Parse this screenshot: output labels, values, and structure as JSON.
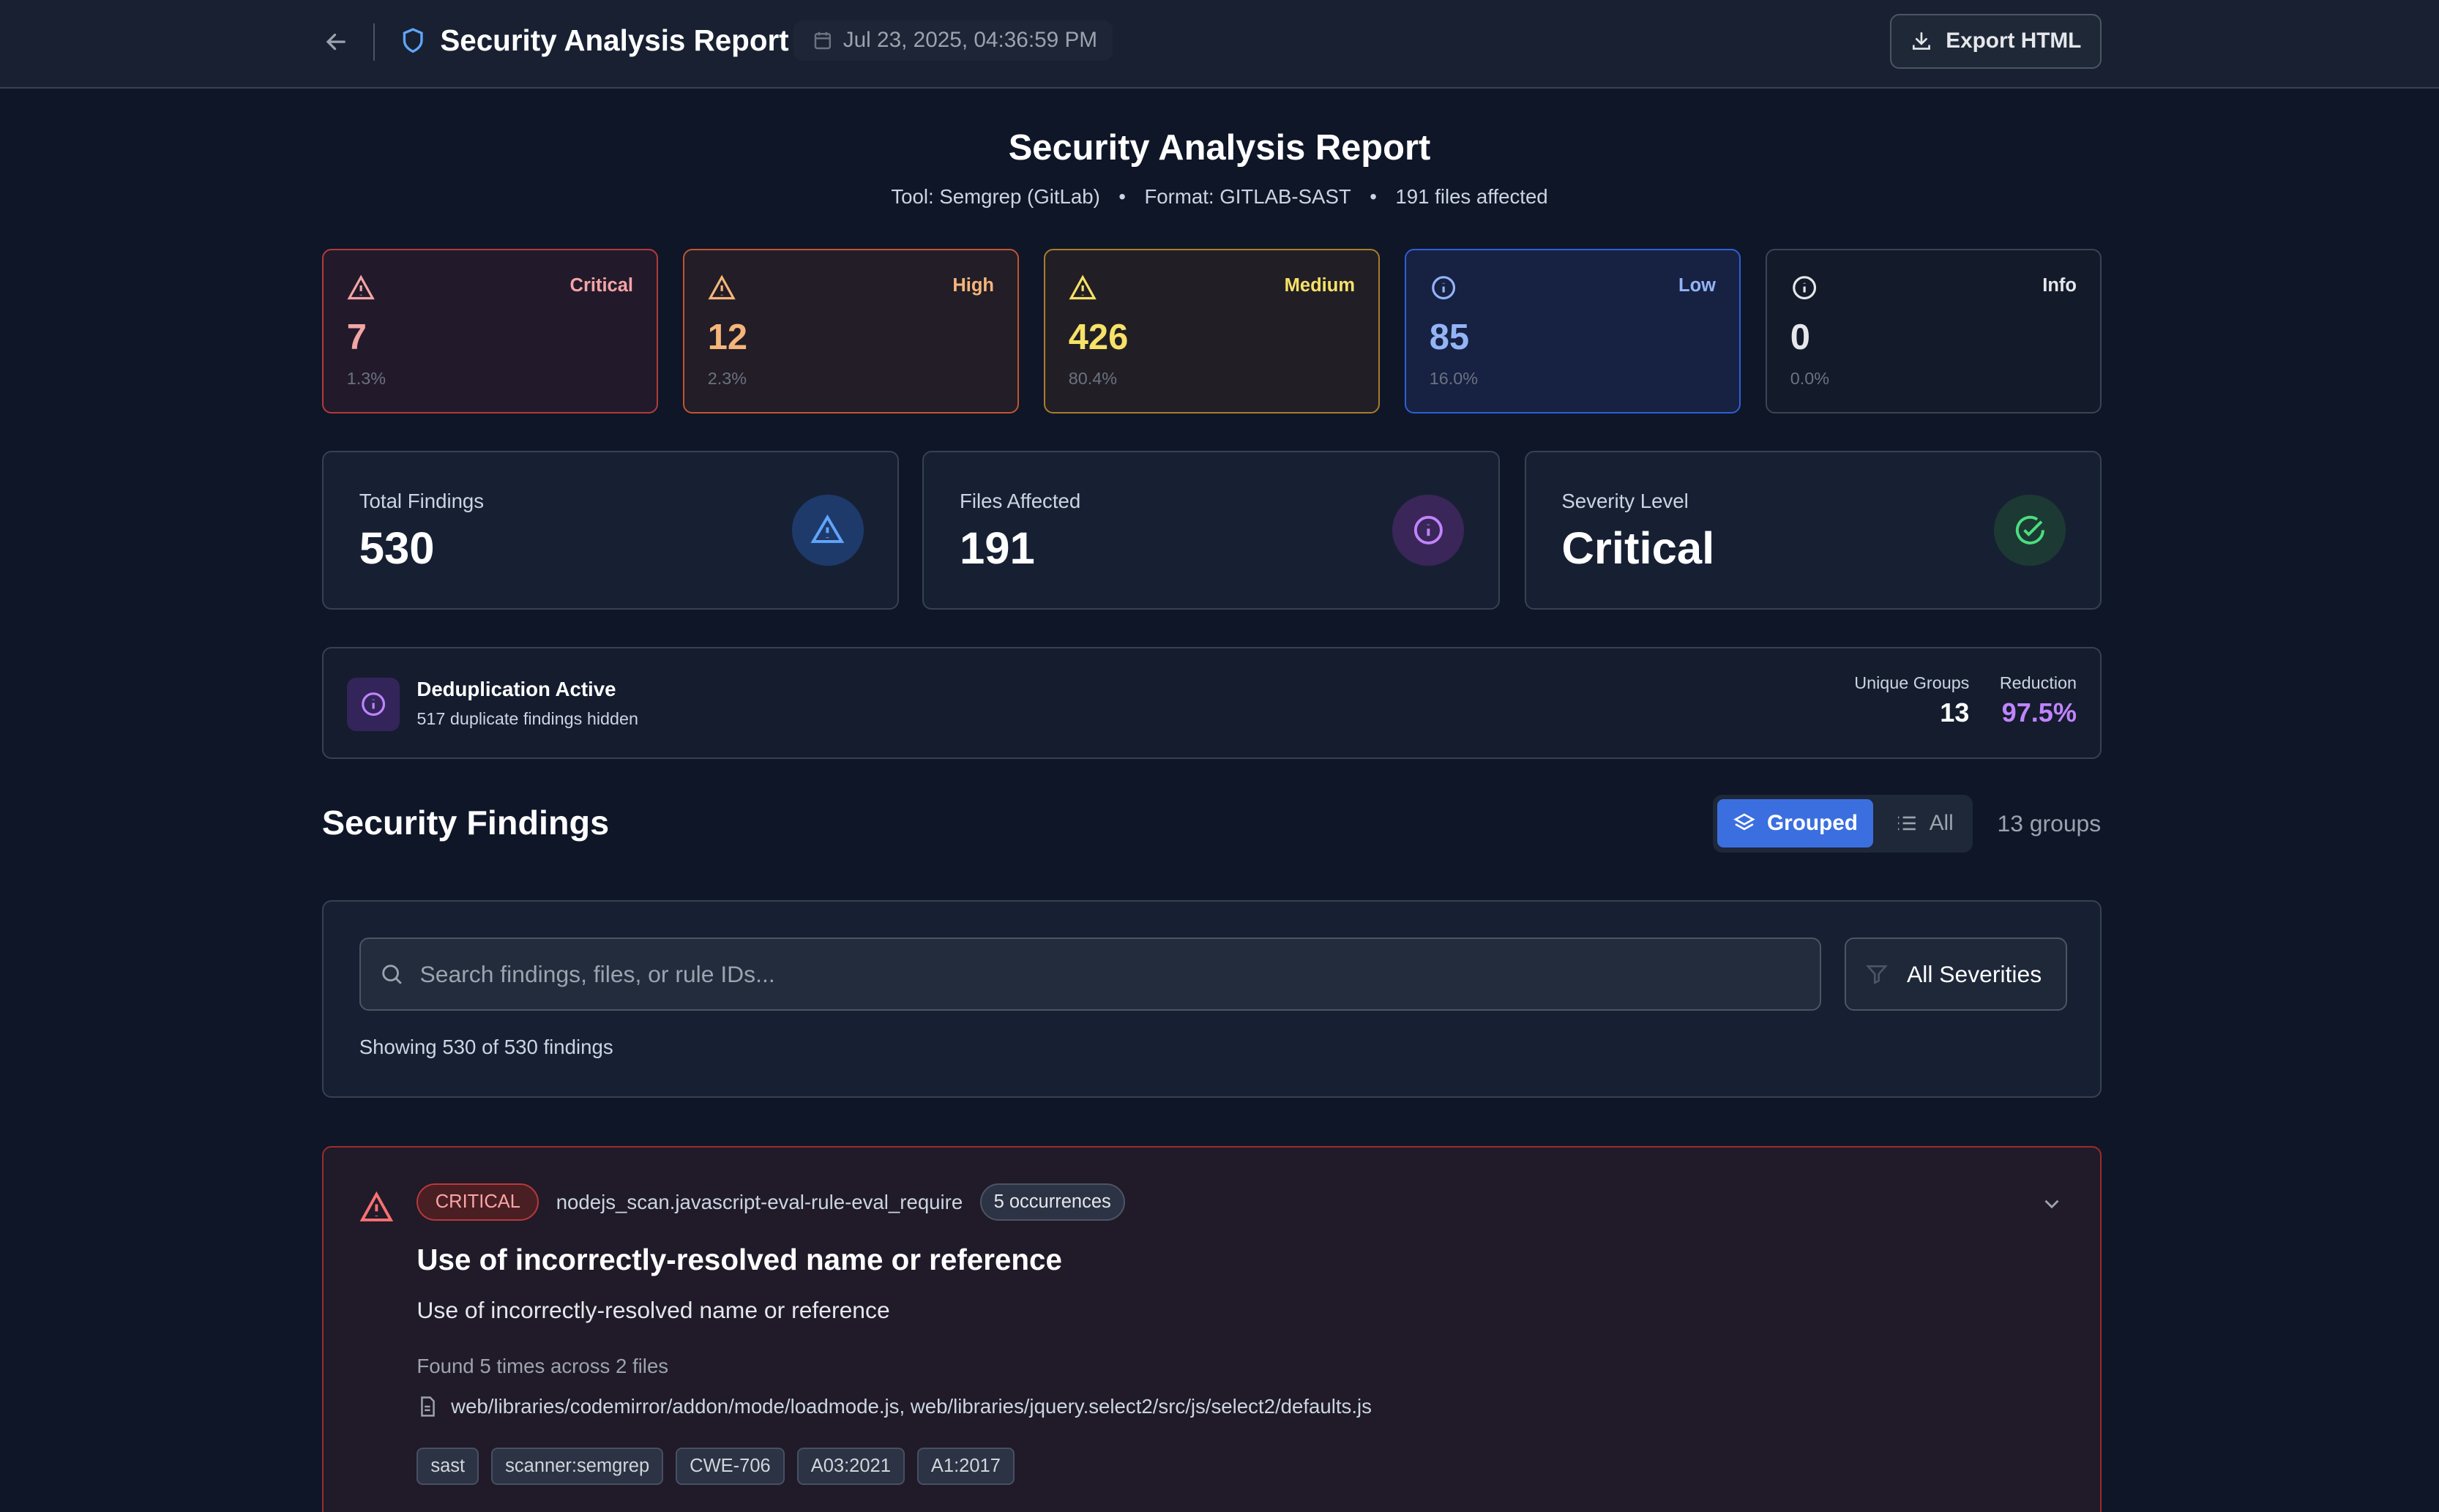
{
  "header": {
    "title": "Security Analysis Report",
    "timestamp": "Jul 23, 2025, 04:36:59 PM",
    "export_label": "Export HTML"
  },
  "report": {
    "title": "Security Analysis Report",
    "tool": "Tool: Semgrep (GitLab)",
    "format": "Format: GITLAB-SAST",
    "files": "191 files affected",
    "separator": "•"
  },
  "severity_cards": [
    {
      "label": "Critical",
      "count": "7",
      "percent": "1.3%",
      "color": "#f4a5a5"
    },
    {
      "label": "High",
      "count": "12",
      "percent": "2.3%",
      "color": "#f5b57a"
    },
    {
      "label": "Medium",
      "count": "426",
      "percent": "80.4%",
      "color": "#f7e168"
    },
    {
      "label": "Low",
      "count": "85",
      "percent": "16.0%",
      "color": "#93b4f5"
    },
    {
      "label": "Info",
      "count": "0",
      "percent": "0.0%",
      "color": "#e5e7eb"
    }
  ],
  "stats": [
    {
      "label": "Total Findings",
      "value": "530"
    },
    {
      "label": "Files Affected",
      "value": "191"
    },
    {
      "label": "Severity Level",
      "value": "Critical"
    }
  ],
  "dedup": {
    "title": "Deduplication Active",
    "subtitle": "517 duplicate findings hidden",
    "groups_label": "Unique Groups",
    "groups_value": "13",
    "reduction_label": "Reduction",
    "reduction_value": "97.5%"
  },
  "findings": {
    "title": "Security Findings",
    "grouped_label": "Grouped",
    "all_label": "All",
    "groups_count": "13 groups",
    "search_placeholder": "Search findings, files, or rule IDs...",
    "search_value": "",
    "severity_filter": "All Severities",
    "showing": "Showing 530 of 530 findings"
  },
  "finding": {
    "severity": "CRITICAL",
    "rule": "nodejs_scan.javascript-eval-rule-eval_require",
    "occurrences": "5 occurrences",
    "title": "Use of incorrectly-resolved name or reference",
    "description": "Use of incorrectly-resolved name or reference",
    "found": "Found 5 times across 2 files",
    "files": "web/libraries/codemirror/addon/mode/loadmode.js, web/libraries/jquery.select2/src/js/select2/defaults.js",
    "tags": [
      "sast",
      "scanner:semgrep",
      "CWE-706",
      "A03:2021",
      "A1:2017"
    ]
  }
}
